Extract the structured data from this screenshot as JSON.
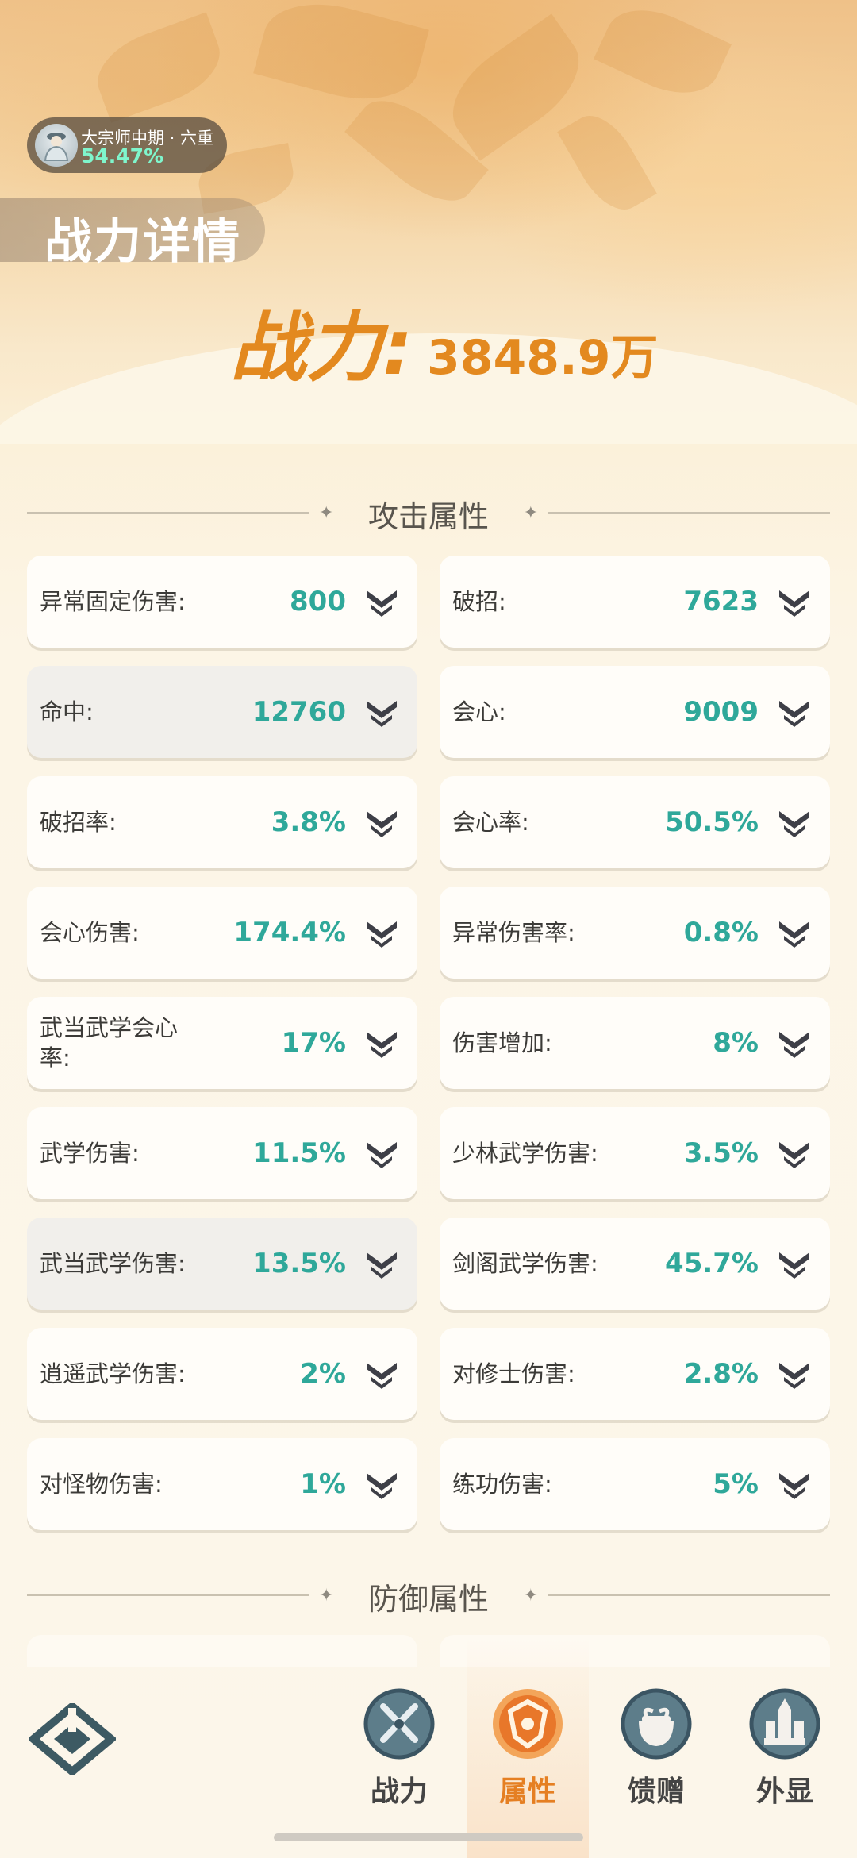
{
  "header": {
    "realm": {
      "name": "大宗师中期 · 六重",
      "percent": "54.47%"
    },
    "title": "战力详情",
    "power": {
      "label": "战力:",
      "value": "3848.9万"
    }
  },
  "sections": {
    "attack": "攻击属性",
    "defense": "防御属性"
  },
  "attack_stats": [
    {
      "label": "异常固定伤害:",
      "value": "800"
    },
    {
      "label": "破招:",
      "value": "7623"
    },
    {
      "label": "命中:",
      "value": "12760"
    },
    {
      "label": "会心:",
      "value": "9009"
    },
    {
      "label": "破招率:",
      "value": "3.8%"
    },
    {
      "label": "会心率:",
      "value": "50.5%"
    },
    {
      "label": "会心伤害:",
      "value": "174.4%"
    },
    {
      "label": "异常伤害率:",
      "value": "0.8%"
    },
    {
      "label": "武当武学会心率:",
      "value": "17%"
    },
    {
      "label": "伤害增加:",
      "value": "8%"
    },
    {
      "label": "武学伤害:",
      "value": "11.5%"
    },
    {
      "label": "少林武学伤害:",
      "value": "3.5%"
    },
    {
      "label": "武当武学伤害:",
      "value": "13.5%"
    },
    {
      "label": "剑阁武学伤害:",
      "value": "45.7%"
    },
    {
      "label": "逍遥武学伤害:",
      "value": "2%"
    },
    {
      "label": "对修士伤害:",
      "value": "2.8%"
    },
    {
      "label": "对怪物伤害:",
      "value": "1%"
    },
    {
      "label": "练功伤害:",
      "value": "5%"
    }
  ],
  "nav": {
    "items": [
      {
        "label": "战力",
        "icon": "swords-icon"
      },
      {
        "label": "属性",
        "icon": "shield-icon"
      },
      {
        "label": "馈赠",
        "icon": "gift-bag-icon"
      },
      {
        "label": "外显",
        "icon": "castle-icon"
      }
    ],
    "active": "属性"
  },
  "colors": {
    "accent_orange": "#e3891f",
    "value_teal": "#2fa89a",
    "realm_percent": "#7ff5cc"
  }
}
